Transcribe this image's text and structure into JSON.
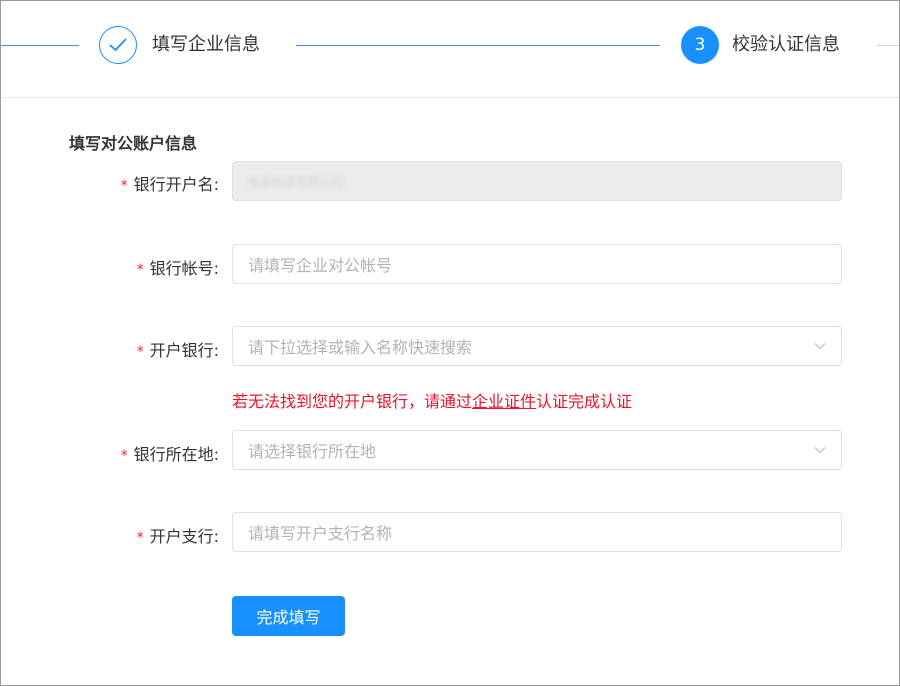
{
  "stepper": {
    "step2_label": "填写企业信息",
    "step3_number": "3",
    "step3_label": "校验认证信息"
  },
  "form": {
    "section_title": "填写对公账户信息",
    "required_mark": "*",
    "bank_account_name": {
      "label": "银行开户名:",
      "value": "某某科技有限公司"
    },
    "bank_account_number": {
      "label": "银行帐号:",
      "placeholder": "请填写企业对公帐号"
    },
    "opening_bank": {
      "label": "开户银行:",
      "placeholder": "请下拉选择或输入名称快速搜索"
    },
    "hint": {
      "prefix": "若无法找到您的开户银行，请通过",
      "link": "企业证件",
      "suffix": "认证完成认证"
    },
    "bank_location": {
      "label": "银行所在地:",
      "placeholder": "请选择银行所在地"
    },
    "branch_bank": {
      "label": "开户支行:",
      "placeholder": "请填写开户支行名称"
    },
    "submit_label": "完成填写"
  },
  "colors": {
    "primary": "#1890ff",
    "error": "#e8142d",
    "disabled_bg": "#ececec"
  }
}
